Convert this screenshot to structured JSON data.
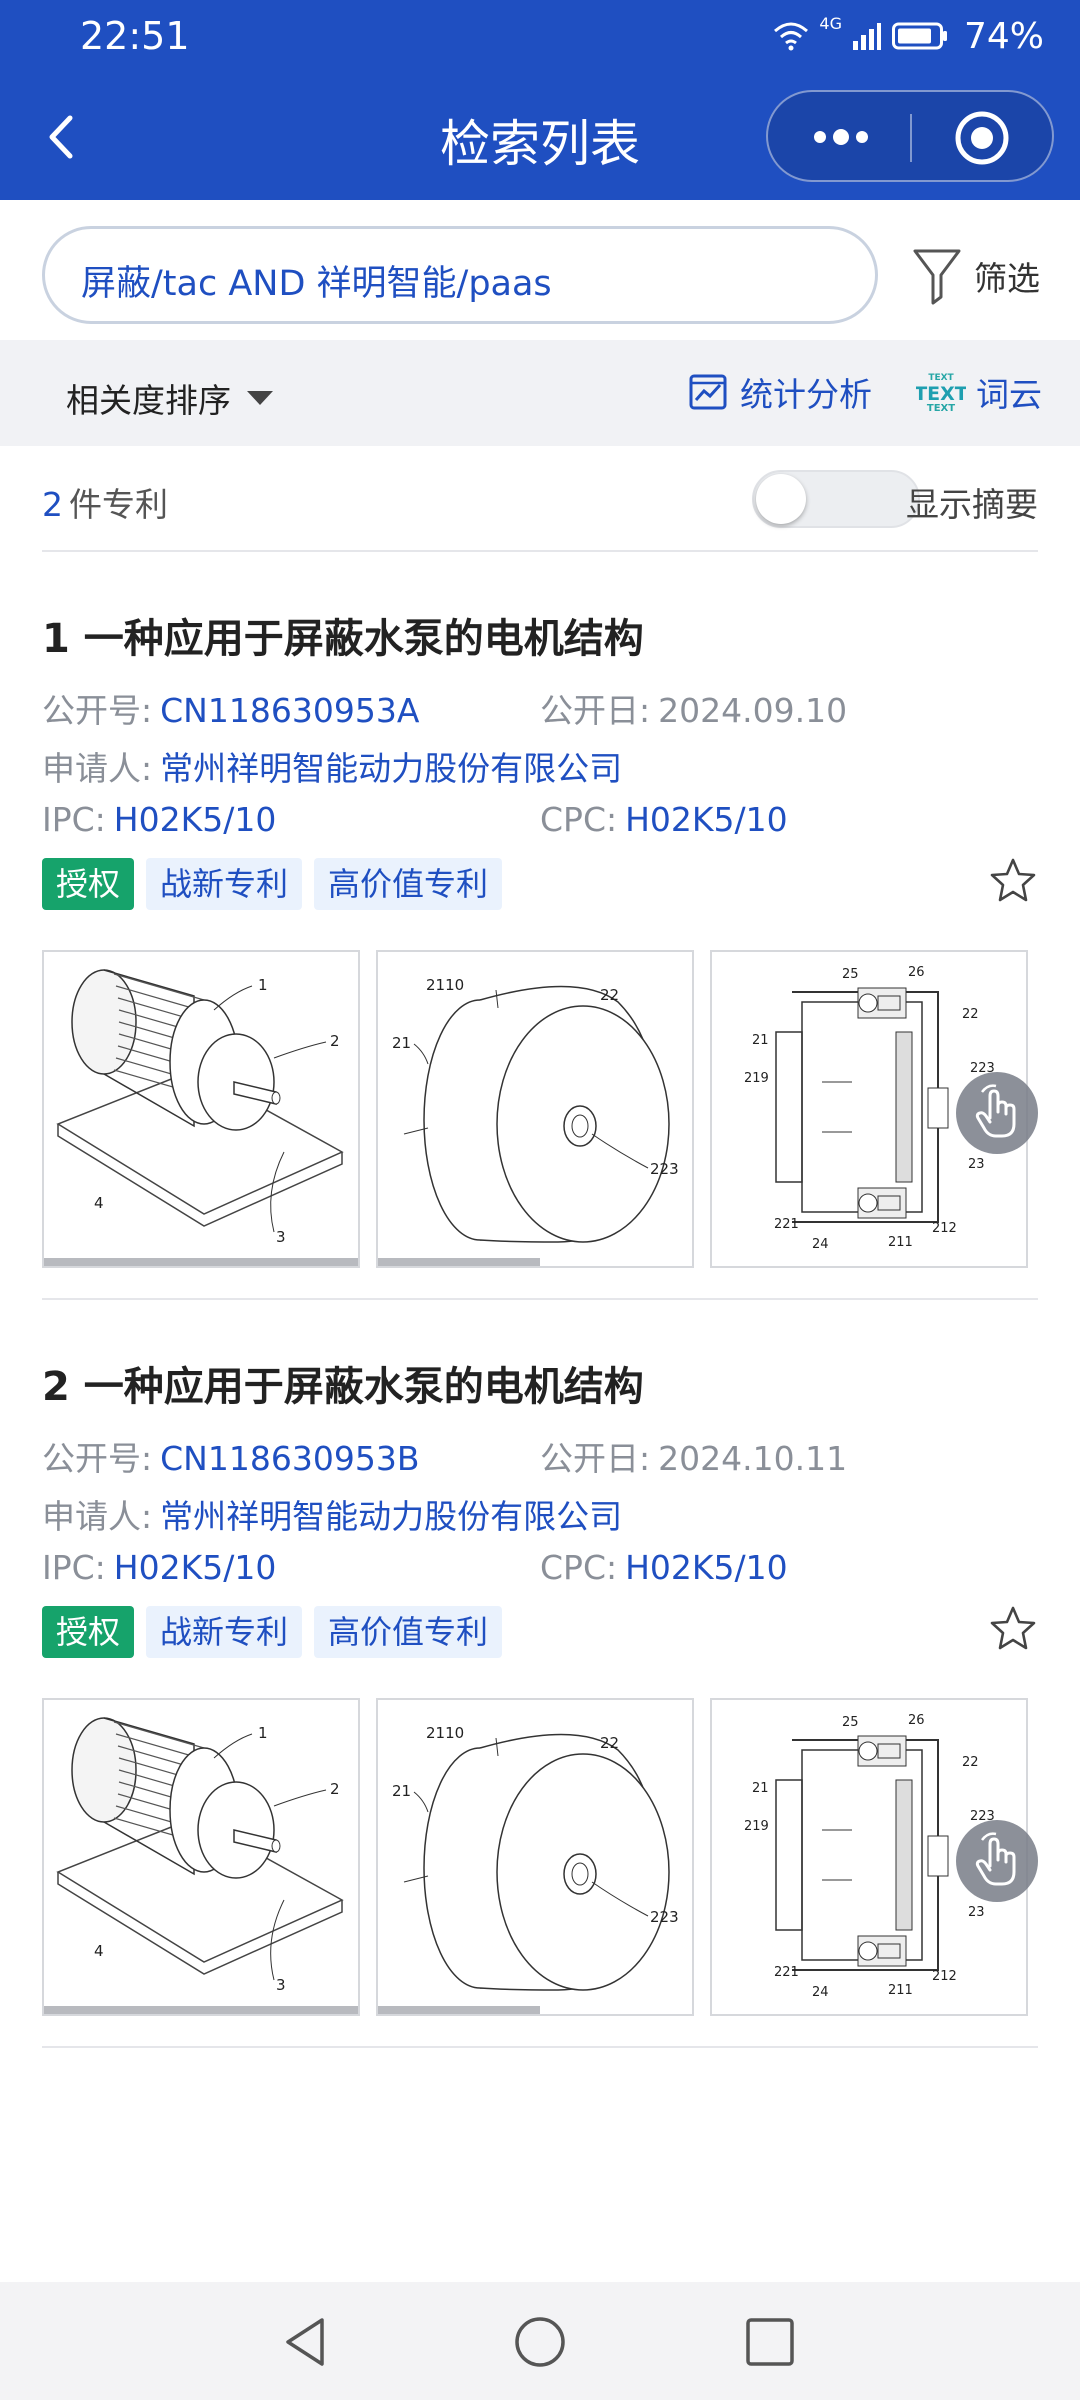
{
  "status_bar": {
    "time": "22:51",
    "network": "4G",
    "battery": "74%"
  },
  "nav": {
    "title": "检索列表",
    "back_icon": "chevron-left-icon",
    "more_icon": "more-dots-icon",
    "close_icon": "target-circle-icon"
  },
  "search": {
    "query": "屏蔽/tac AND 祥明智能/paas",
    "filter_label": "筛选"
  },
  "toolbar": {
    "sort_label": "相关度排序",
    "stats_label": "统计分析",
    "wordcloud_label": "词云",
    "wordcloud_icon_text": "TEXT"
  },
  "results": {
    "count": "2",
    "count_suffix": "件专利",
    "abstract_toggle_label": "显示摘要",
    "abstract_on": false
  },
  "labels": {
    "pub_no": "公开号:",
    "pub_date": "公开日:",
    "applicant": "申请人:",
    "ipc": "IPC:",
    "cpc": "CPC:"
  },
  "patents": [
    {
      "title": "1 一种应用于屏蔽水泵的电机结构",
      "pub_no": "CN118630953A",
      "pub_date": "2024.09.10",
      "applicant": "常州祥明智能动力股份有限公司",
      "ipc": "H02K5/10",
      "cpc": "H02K5/10",
      "tags": [
        "授权",
        "战新专利",
        "高价值专利"
      ],
      "fig1_labels": [
        "1",
        "2",
        "3",
        "4"
      ],
      "fig2_labels": [
        "2110",
        "22",
        "21",
        "223"
      ],
      "fig3_labels": [
        "25",
        "26",
        "22",
        "21",
        "219",
        "223",
        "23",
        "221",
        "24",
        "211",
        "212"
      ]
    },
    {
      "title": "2 一种应用于屏蔽水泵的电机结构",
      "pub_no": "CN118630953B",
      "pub_date": "2024.10.11",
      "applicant": "常州祥明智能动力股份有限公司",
      "ipc": "H02K5/10",
      "cpc": "H02K5/10",
      "tags": [
        "授权",
        "战新专利",
        "高价值专利"
      ],
      "fig1_labels": [
        "1",
        "2",
        "3",
        "4"
      ],
      "fig2_labels": [
        "2110",
        "22",
        "21",
        "223"
      ],
      "fig3_labels": [
        "25",
        "26",
        "22",
        "21",
        "219",
        "223",
        "23",
        "221",
        "24",
        "211",
        "212"
      ]
    }
  ],
  "colors": {
    "primary": "#1f4fc1",
    "tag_green": "#16a36b",
    "tag_blue_bg": "#eaf2fd"
  }
}
